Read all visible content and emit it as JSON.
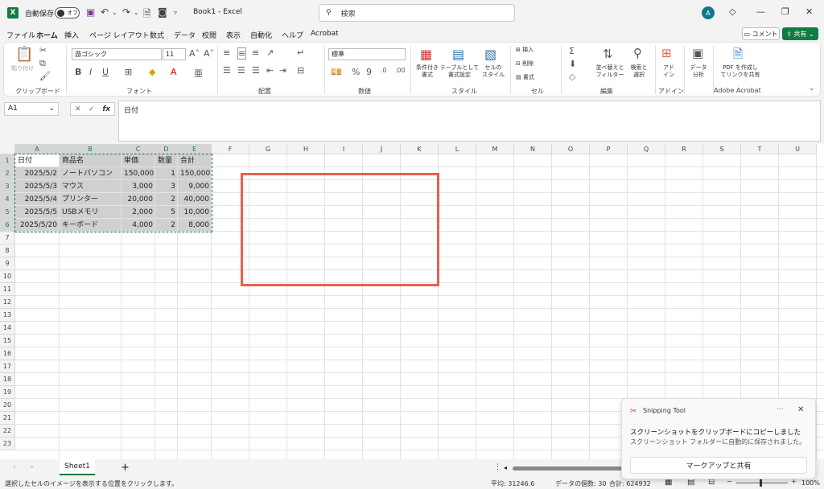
{
  "titlebar": {
    "autosave_label": "自動保存",
    "autosave_state": "オフ",
    "doc_title": "Book1 - Excel",
    "search_placeholder": "検索",
    "avatar_initial": "A"
  },
  "menu": [
    "ファイル",
    "ホーム",
    "挿入",
    "ページ レイアウト",
    "数式",
    "データ",
    "校閲",
    "表示",
    "自動化",
    "ヘルプ",
    "Acrobat"
  ],
  "comment_label": "コメント",
  "share_label": "共有",
  "ribbon": {
    "paste_label": "貼り付け",
    "font_name": "游ゴシック",
    "font_size": "11",
    "number_format": "標準",
    "cond_format": "条件付き\n書式",
    "table_format": "テーブルとして\n書式設定",
    "cell_style": "セルの\nスタイル",
    "insert": "挿入",
    "delete": "削除",
    "format": "書式",
    "sort_filter": "並べ替えと\nフィルター",
    "find_select": "検索と\n選択",
    "addins": "アド\nイン",
    "data_analysis": "データ\n分析",
    "acrobat_pdf": "PDF を作成し\nてリンクを共有",
    "groups": [
      "クリップボード",
      "フォント",
      "配置",
      "数値",
      "スタイル",
      "セル",
      "編集",
      "アドイン",
      "Adobe Acrobat"
    ]
  },
  "namebox": "A1",
  "fx": "fx",
  "formula": "日付",
  "columns": [
    "A",
    "B",
    "C",
    "D",
    "E",
    "F",
    "G",
    "H",
    "I",
    "J",
    "K",
    "L",
    "M",
    "N",
    "O",
    "P",
    "Q",
    "R",
    "S",
    "T",
    "U"
  ],
  "rows": [
    "1",
    "2",
    "3",
    "4",
    "5",
    "6",
    "7",
    "8",
    "9",
    "10",
    "11",
    "12",
    "13",
    "14",
    "15",
    "16",
    "17",
    "18",
    "19",
    "20",
    "21",
    "22",
    "23"
  ],
  "table": [
    [
      "日付",
      "商品名",
      "単価",
      "数量",
      "合計"
    ],
    [
      "2025/5/2",
      "ノートパソコン",
      "150,000",
      "1",
      "150,000"
    ],
    [
      "2025/5/3",
      "マウス",
      "3,000",
      "3",
      "9,000"
    ],
    [
      "2025/5/4",
      "プリンター",
      "20,000",
      "2",
      "40,000"
    ],
    [
      "2025/5/5",
      "USBメモリ",
      "2,000",
      "5",
      "10,000"
    ],
    [
      "2025/5/20",
      "キーボード",
      "4,000",
      "2",
      "8,000"
    ]
  ],
  "sheet_tab": "Sheet1",
  "status": {
    "message": "選択したセルのイメージを表示する位置をクリックします。",
    "average": "平均: 31246.6",
    "count": "データの個数: 30",
    "sum": "合計: 624932",
    "zoom": "100%"
  },
  "toast": {
    "app": "Snipping Tool",
    "title": "スクリーンショットをクリップボードにコピーしました",
    "body": "スクリーンショット フォルダーに自動的に保存されました。",
    "button": "マークアップと共有"
  }
}
